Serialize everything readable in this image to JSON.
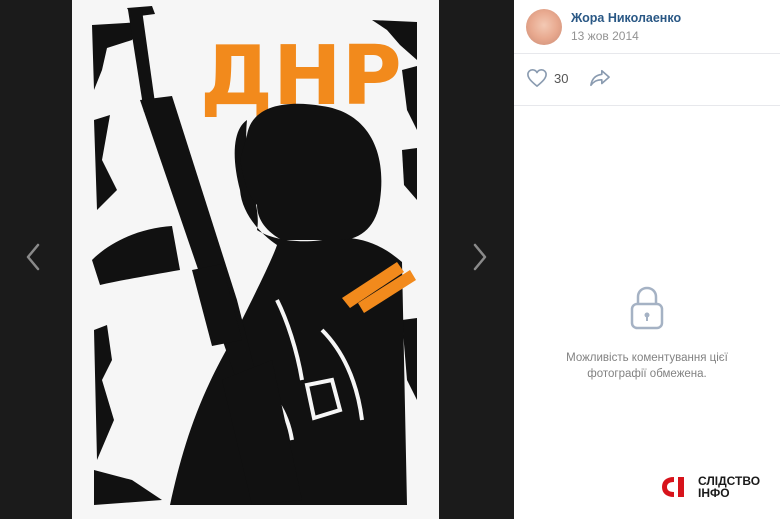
{
  "post": {
    "author_name": "Жора Николаенко",
    "date": "13 жов 2014",
    "like_count": "30"
  },
  "comments": {
    "closed_message": "Можливість коментування цієї фотографії обмежена."
  },
  "poster": {
    "headline": "ДНР",
    "headline_color": "#f28a1c",
    "ribbon_color": "#f28a1c"
  },
  "watermark": {
    "line1": "СЛІДСТВО",
    "line2": "ІНФО",
    "logo_color": "#d7131b"
  },
  "icons": {
    "nav_prev": "chevron-left-icon",
    "nav_next": "chevron-right-icon",
    "like": "heart-icon",
    "share": "share-arrow-icon",
    "lock": "lock-icon"
  }
}
